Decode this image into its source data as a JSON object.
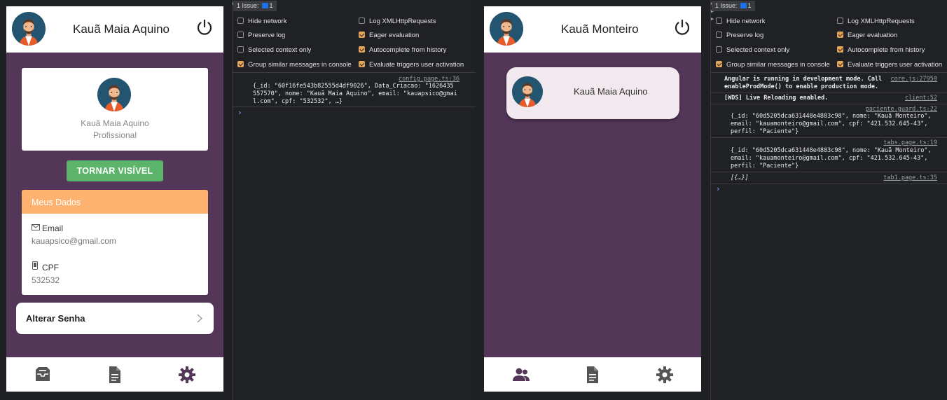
{
  "left_app": {
    "header_name": "Kauã Maia Aquino",
    "profile": {
      "name": "Kauã Maia Aquino",
      "role": "Profissional"
    },
    "visible_button": "TORNAR VISÍVEL",
    "data_card": {
      "title": "Meus Dados",
      "email_label": "Email",
      "email_value": "kauapsico@gmail.com",
      "cpf_label": "CPF",
      "cpf_value": "532532"
    },
    "password_label": "Alterar Senha",
    "tabs": [
      "inbox-icon",
      "document-icon",
      "gear-icon"
    ]
  },
  "right_app": {
    "header_name": "Kauã Monteiro",
    "patient_name": "Kauã Maia Aquino",
    "tabs": [
      "people-icon",
      "document-icon",
      "gear-icon"
    ]
  },
  "devtools_left": {
    "issues_label": "1 Issue:",
    "issues_count": "1",
    "options": [
      {
        "label": "Hide network",
        "checked": false
      },
      {
        "label": "Log XMLHttpRequests",
        "checked": false
      },
      {
        "label": "Preserve log",
        "checked": false
      },
      {
        "label": "Eager evaluation",
        "checked": true
      },
      {
        "label": "Selected context only",
        "checked": false
      },
      {
        "label": "Autocomplete from history",
        "checked": true
      },
      {
        "label": "Group similar messages in console",
        "checked": true
      },
      {
        "label": "Evaluate triggers user activation",
        "checked": true
      }
    ],
    "log": {
      "source": "config.page.ts:36",
      "line1": "{_id: \"60f16fe543b82555d4df9026\", Data_Criacao: \"1626435",
      "line2": "557570\", nome: \"Kauã Maia Aquino\", email: \"kauapsico@gmai",
      "line3": "l.com\", cpf: \"532532\", …}"
    }
  },
  "devtools_right": {
    "issues_label": "1 Issue:",
    "issues_count": "1",
    "options": [
      {
        "label": "Hide network",
        "checked": false
      },
      {
        "label": "Log XMLHttpRequests",
        "checked": false
      },
      {
        "label": "Preserve log",
        "checked": false
      },
      {
        "label": "Eager evaluation",
        "checked": true
      },
      {
        "label": "Selected context only",
        "checked": false
      },
      {
        "label": "Autocomplete from history",
        "checked": true
      },
      {
        "label": "Group similar messages in console",
        "checked": true
      },
      {
        "label": "Evaluate triggers user activation",
        "checked": true
      }
    ],
    "logs": {
      "angular_line1": "Angular is running in development mode. Call",
      "angular_source": "core.js:27950",
      "angular_line2": "enableProdMode() to enable production mode.",
      "wds_line": "[WDS] Live Reloading enabled.",
      "wds_source": "client:52",
      "guard_source": "paciente.guard.ts:22",
      "guard_line1": "{_id: \"60d5205dca631448e4883c98\", nome: \"Kauã Monteiro\",",
      "guard_line2": "email: \"kauamonteiro@gmail.com\", cpf: \"421.532.645-43\",",
      "guard_line3": "perfil: \"Paciente\"}",
      "tabs_source": "tabs.page.ts:19",
      "tabs_line1": "{_id: \"60d5205dca631448e4883c98\", nome: \"Kauã Monteiro\",",
      "tabs_line2": "email: \"kauamonteiro@gmail.com\", cpf: \"421.532.645-43\",",
      "tabs_line3": "perfil: \"Paciente\"}",
      "array_line": "[{…}]",
      "array_source": "tab1.page.ts:35"
    }
  },
  "colors": {
    "app_bg": "#533658",
    "accent_green": "#5bb46a",
    "accent_orange": "#fdb270",
    "devtools_bg": "#202124",
    "string_color": "#5cd5fb",
    "checkbox_on": "#e5a657"
  }
}
